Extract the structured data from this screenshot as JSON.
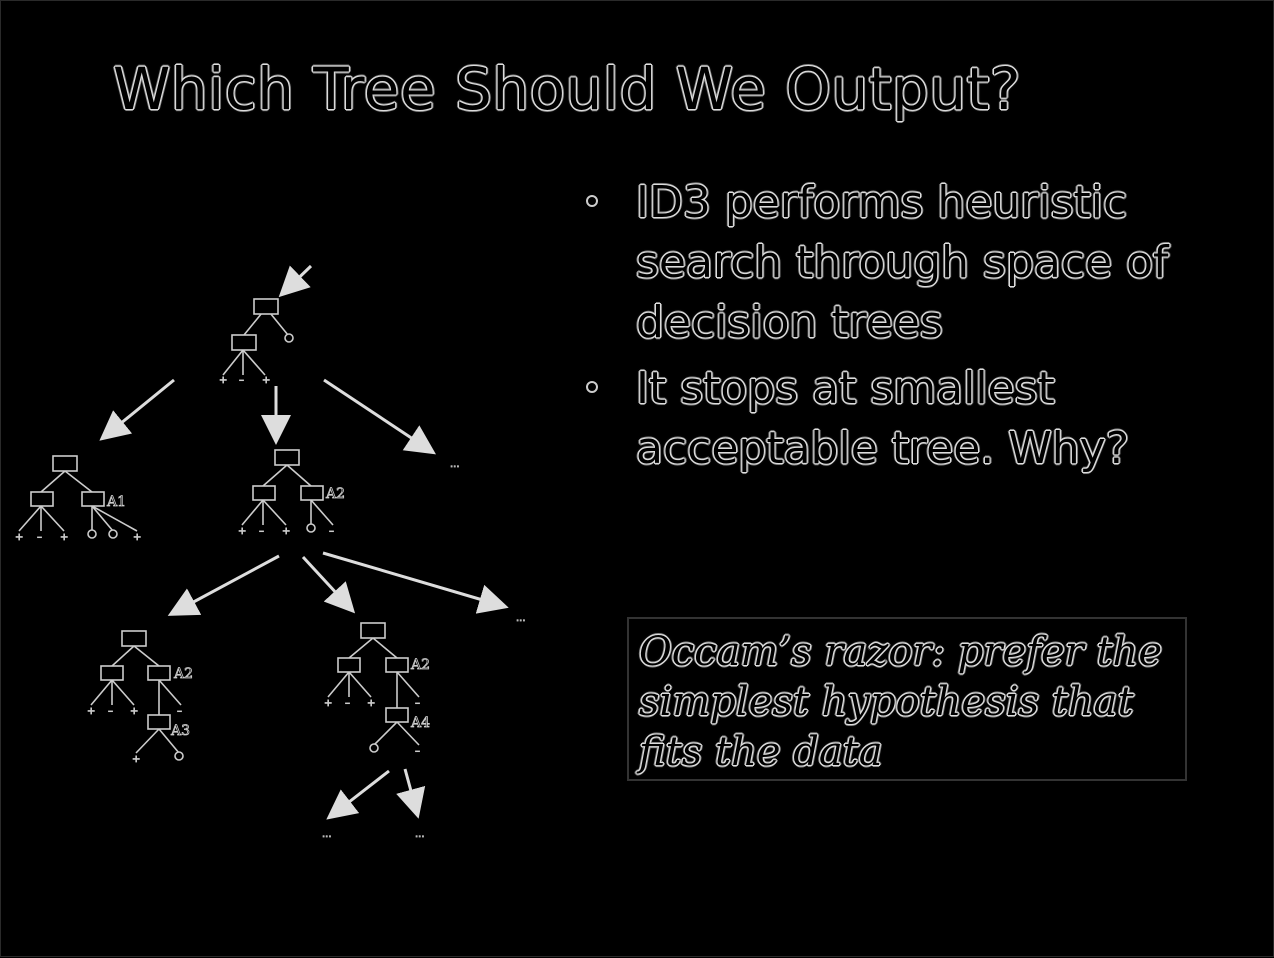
{
  "slide": {
    "title": "Which Tree Should We Output?",
    "bullets": [
      "ID3 performs heuristic search through space of decision trees",
      "It stops at smallest acceptable tree. Why?"
    ],
    "occam_box": "Occam’s razor: prefer the simplest hypothesis that fits the data"
  },
  "diagram": {
    "attribute_labels": {
      "a1": "A1",
      "a2_level1": "A2",
      "a2_level2_left": "A2",
      "a3": "A3",
      "a2_level2_right": "A2",
      "a4": "A4"
    },
    "leaf_labels": {
      "plus": "+",
      "minus": "–",
      "ellipsis": "..."
    }
  }
}
